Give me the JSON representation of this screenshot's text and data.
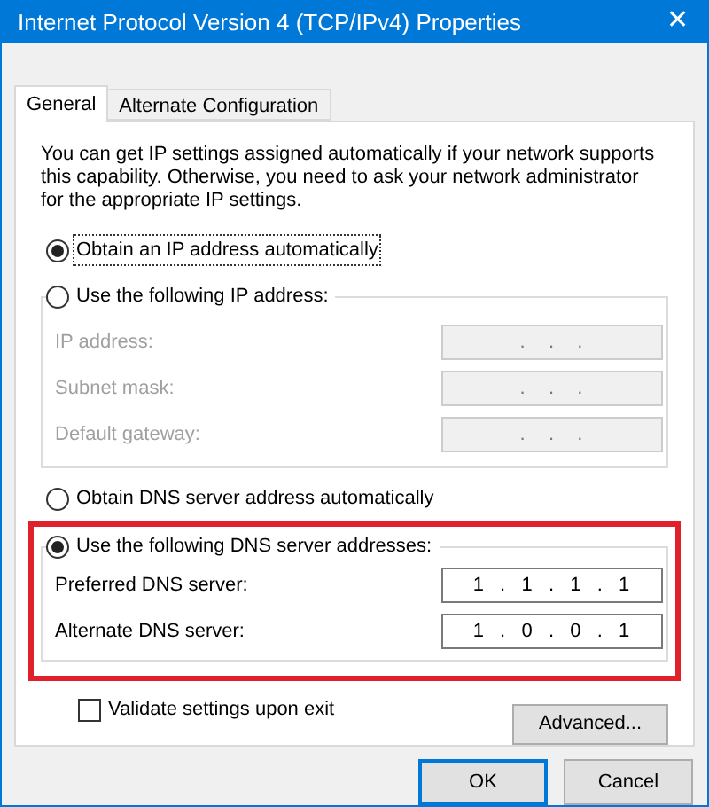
{
  "window": {
    "title": "Internet Protocol Version 4 (TCP/IPv4) Properties",
    "close": "✕"
  },
  "tabs": [
    {
      "label": "General",
      "selected": true
    },
    {
      "label": "Alternate Configuration",
      "selected": false
    }
  ],
  "description": "You can get IP settings assigned automatically if your network supports this capability. Otherwise, you need to ask your network administrator for the appropriate IP settings.",
  "ip_mode": [
    {
      "label": "Obtain an IP address automatically",
      "selected": true,
      "focused": true
    },
    {
      "label": "Use the following IP address:",
      "selected": false,
      "focused": false
    }
  ],
  "ip_fields": [
    {
      "label": "IP address:",
      "value": ".   .   .",
      "disabled": true
    },
    {
      "label": "Subnet mask:",
      "value": ".   .   .",
      "disabled": true
    },
    {
      "label": "Default gateway:",
      "value": ".   .   .",
      "disabled": true
    }
  ],
  "dns_mode": [
    {
      "label": "Obtain DNS server address automatically",
      "selected": false,
      "focused": false
    },
    {
      "label": "Use the following DNS server addresses:",
      "selected": true,
      "focused": false
    }
  ],
  "dns_fields": [
    {
      "label": "Preferred DNS server:",
      "value": "1  .  1  .  1  .  1",
      "disabled": false
    },
    {
      "label": "Alternate DNS server:",
      "value": "1  .  0  .  0  .  1",
      "disabled": false
    }
  ],
  "validate": {
    "label": "Validate settings upon exit",
    "checked": false
  },
  "advanced_button": "Advanced...",
  "buttons": [
    {
      "label": "OK",
      "default": true
    },
    {
      "label": "Cancel",
      "default": false
    }
  ]
}
